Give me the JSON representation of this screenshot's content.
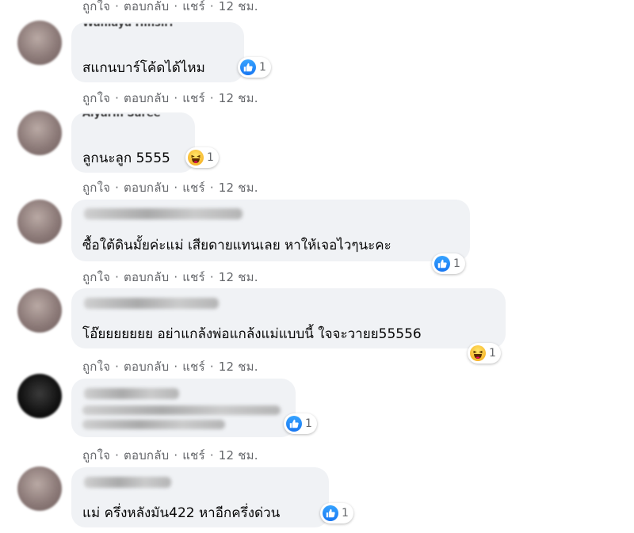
{
  "action_bar": {
    "like": "ถูกใจ",
    "reply": "ตอบกลับ",
    "share": "แชร์",
    "dot": "·",
    "time": "12 ชม."
  },
  "comments": [
    {
      "name": "Wanlaya Hinsiri",
      "text": "สแกนบาร์โค้ดได้ไหม",
      "reaction": "like",
      "count": "1"
    },
    {
      "name": "Aiyarin Saree",
      "text": "ลูกนะลูก 5555",
      "reaction": "haha",
      "count": "1"
    },
    {
      "name": "",
      "text": "ซื้อใต้ดินมั้ยค่ะแม่ เสียดายแทนเลย หาให้เจอไวๆนะคะ",
      "reaction": "like",
      "count": "1"
    },
    {
      "name": "",
      "text": "โอ๊ยยยยยยย อย่าแกล้งพ่อแกล้งแม่แบบนี้ ใจจะวายย55556",
      "reaction": "haha",
      "count": "1"
    },
    {
      "name": "",
      "text": "",
      "reaction": "like",
      "count": "1"
    },
    {
      "name": "",
      "text": "แม่ ครึ่งหลังมัน422 หาอีกครึ่งด่วน",
      "reaction": "like",
      "count": "1"
    }
  ],
  "colors": {
    "bubble": "#f0f2f5",
    "action_text": "#65676b",
    "like_blue": "#1877f2",
    "haha_yellow": "#f7b125"
  },
  "icons": {
    "like": "thumbs-up-icon",
    "haha": "laughing-face-icon"
  }
}
